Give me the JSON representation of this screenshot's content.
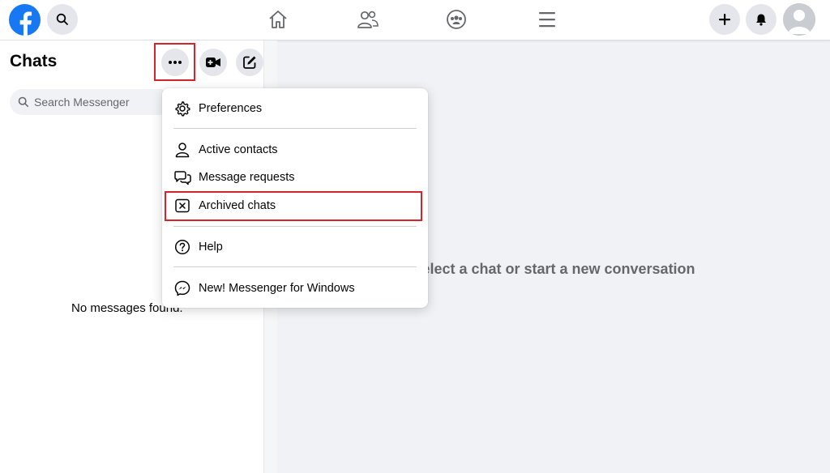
{
  "topbar": {
    "icons": [
      "facebook-logo",
      "search-icon",
      "home-icon",
      "friends-icon",
      "groups-icon",
      "menu-icon",
      "plus-icon",
      "bell-icon",
      "avatar"
    ],
    "brand_color": "#1877f2"
  },
  "chats": {
    "title": "Chats",
    "search_placeholder": "Search Messenger",
    "empty_text": "No messages found."
  },
  "main": {
    "prompt": "Select a chat or start a new conversation"
  },
  "menu": {
    "items": [
      {
        "label": "Preferences",
        "icon": "gear-icon"
      },
      {
        "label": "Active contacts",
        "icon": "person-icon"
      },
      {
        "label": "Message requests",
        "icon": "chat-bubbles-icon"
      },
      {
        "label": "Archived chats",
        "icon": "archive-x-icon"
      },
      {
        "label": "Help",
        "icon": "help-icon"
      },
      {
        "label": "New! Messenger for Windows",
        "icon": "messenger-icon"
      }
    ]
  },
  "highlight_color": "#d8232a"
}
